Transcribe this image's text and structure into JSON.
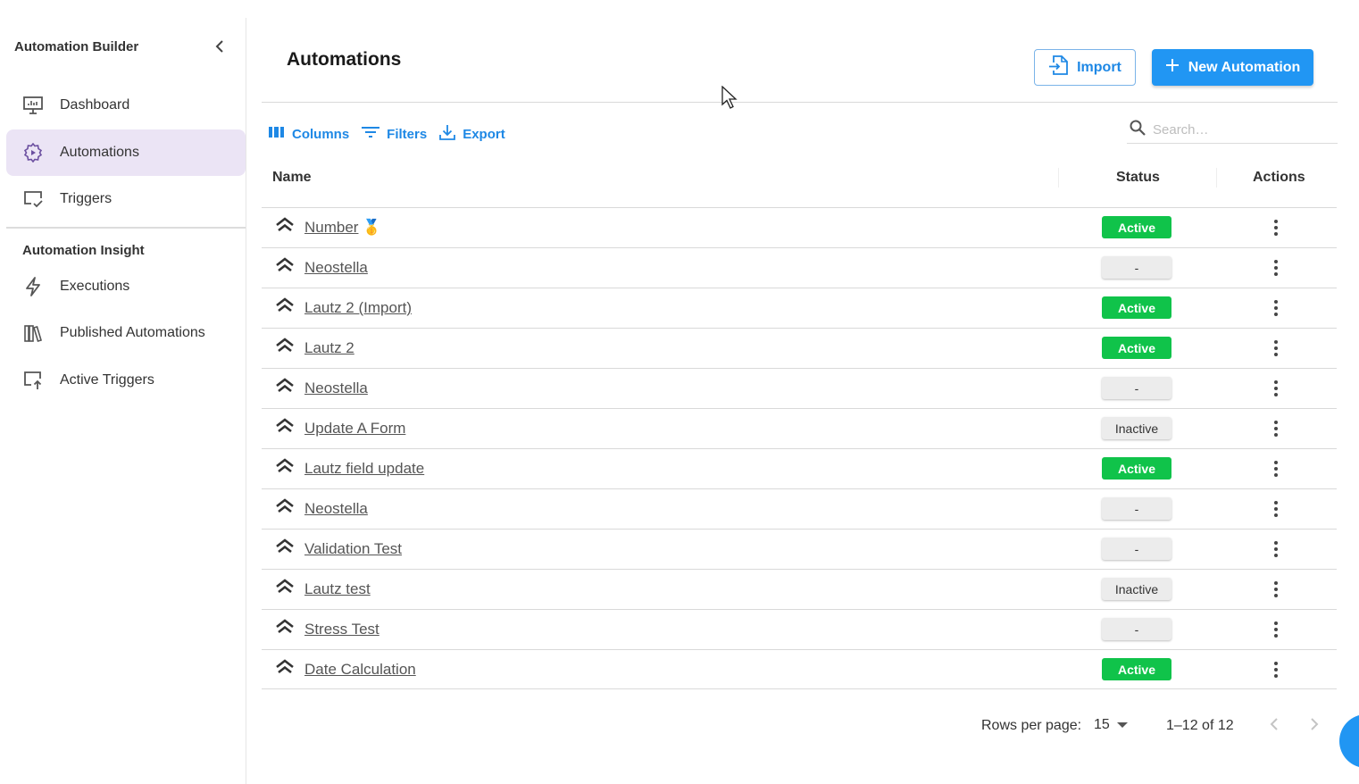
{
  "sidebar": {
    "title": "Automation Builder",
    "items": [
      {
        "label": "Dashboard",
        "icon": "monitor-icon"
      },
      {
        "label": "Automations",
        "icon": "gear-icon"
      },
      {
        "label": "Triggers",
        "icon": "screen-check-icon"
      }
    ],
    "section_title": "Automation Insight",
    "insight_items": [
      {
        "label": "Executions",
        "icon": "lightning-icon"
      },
      {
        "label": "Published Automations",
        "icon": "library-icon"
      },
      {
        "label": "Active Triggers",
        "icon": "screen-arrow-icon"
      }
    ]
  },
  "header": {
    "title": "Automations",
    "import_label": "Import",
    "new_label": "New Automation"
  },
  "toolbar": {
    "columns_label": "Columns",
    "filters_label": "Filters",
    "export_label": "Export",
    "search_placeholder": "Search…"
  },
  "table": {
    "columns": [
      "Name",
      "Status",
      "Actions"
    ],
    "rows": [
      {
        "name": "Number",
        "status": "Active",
        "medal": "🥇"
      },
      {
        "name": "Neostella",
        "status": "-"
      },
      {
        "name": "Lautz 2 (Import)",
        "status": "Active"
      },
      {
        "name": "Lautz 2",
        "status": "Active"
      },
      {
        "name": "Neostella",
        "status": "-"
      },
      {
        "name": "Update A Form",
        "status": "Inactive"
      },
      {
        "name": "Lautz field update",
        "status": "Active"
      },
      {
        "name": "Neostella",
        "status": "-"
      },
      {
        "name": "Validation Test",
        "status": "-"
      },
      {
        "name": "Lautz test",
        "status": "Inactive"
      },
      {
        "name": "Stress Test",
        "status": "-"
      },
      {
        "name": "Date Calculation",
        "status": "Active"
      }
    ]
  },
  "pagination": {
    "rows_label": "Rows per page:",
    "rows_value": "15",
    "range": "1–12 of 12"
  },
  "colors": {
    "accent": "#2196f3",
    "active_badge": "#10c34a",
    "nav_active_bg": "#ebe4f5"
  }
}
